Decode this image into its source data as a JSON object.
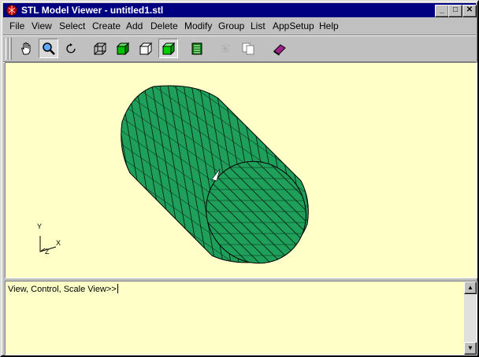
{
  "window": {
    "title": "STL Model Viewer - untitled1.stl"
  },
  "titlebar_buttons": {
    "minimize": "_",
    "maximize": "□",
    "close": "✕"
  },
  "menu": [
    "File",
    "View",
    "Select",
    "Create",
    "Add",
    "Delete",
    "Modify",
    "Group",
    "List",
    "AppSetup",
    "Help"
  ],
  "toolbar": {
    "tools": [
      "pan-hand-icon",
      "zoom-magnifier-icon",
      "rotate-icon",
      "wireframe-cube-icon",
      "shaded-cube-icon",
      "hidden-line-cube-icon",
      "solid-shaded-cube-icon",
      "list-icon",
      "copy-icon",
      "copy-sheets-icon",
      "book-icon"
    ],
    "pressed": [
      "zoom-magnifier-icon",
      "solid-shaded-cube-icon"
    ]
  },
  "viewport": {
    "background": "#ffffc8",
    "model_color": "#1fa05a",
    "axes": {
      "x": "X",
      "y": "Y",
      "z": "Z"
    }
  },
  "console": {
    "prompt": "View, Control, Scale View>>"
  },
  "colors": {
    "titlebar": "#000080",
    "chrome": "#c0c0c0"
  }
}
